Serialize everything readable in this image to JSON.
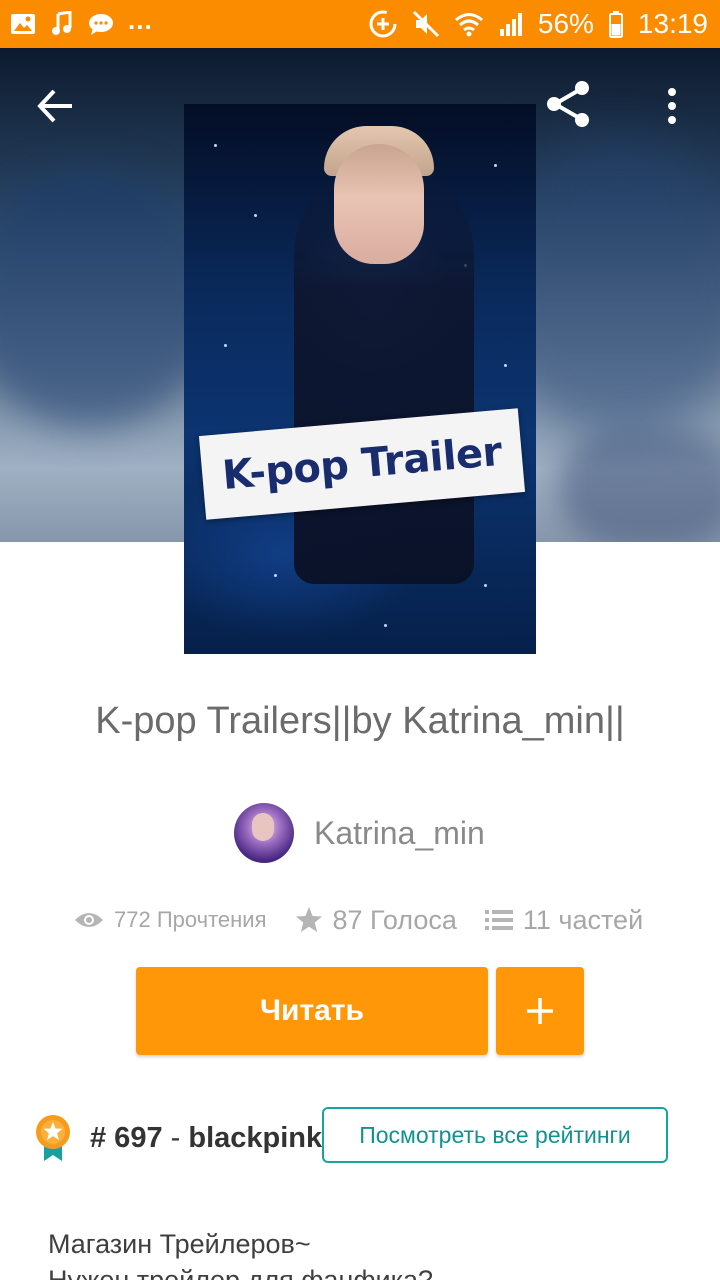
{
  "status_bar": {
    "battery_percent": "56%",
    "time": "13:19",
    "overflow": "..."
  },
  "story": {
    "cover_title": "K-pop Trailer",
    "title": "K-pop Trailers||by Katrina_min||",
    "author": "Katrina_min",
    "stats": {
      "reads": "772 Прочтения",
      "votes": "87 Голоса",
      "parts": "11 частей"
    },
    "read_button": "Читать",
    "add_button": "+",
    "rank": {
      "number": "# 697",
      "separator": " - ",
      "tag": "blackpink"
    },
    "rankings_button": "Посмотреть все рейтинги",
    "description": [
      "Магазин Трейлеров~",
      "Нужен трейлер для фанфика?"
    ]
  },
  "colors": {
    "status_bar": "#fb8c00",
    "primary_button": "#ff9709",
    "rankings_border": "#17a5a3"
  },
  "icons": [
    "image-icon",
    "music-icon",
    "chat-icon",
    "data-saver-icon",
    "mute-icon",
    "wifi-icon",
    "signal-icon",
    "battery-icon",
    "back-arrow-icon",
    "share-icon",
    "more-vert-icon",
    "eye-icon",
    "star-icon",
    "list-icon",
    "plus-icon",
    "award-badge-icon"
  ]
}
